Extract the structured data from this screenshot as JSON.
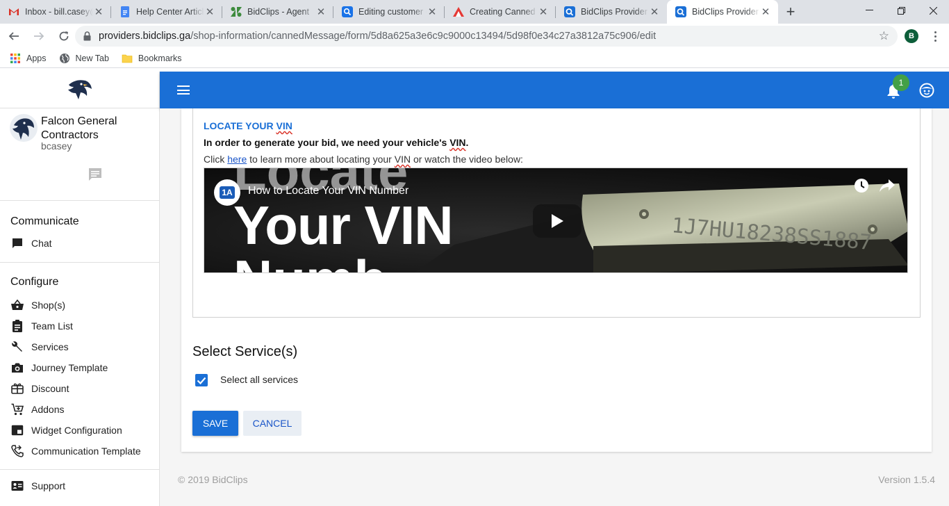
{
  "browser": {
    "tabs": [
      {
        "title": "Inbox - bill.casey@",
        "icon": "gmail-icon"
      },
      {
        "title": "Help Center Article",
        "icon": "docs-icon"
      },
      {
        "title": "BidClips - Agent",
        "icon": "zendesk-icon"
      },
      {
        "title": "Editing customer c",
        "icon": "search-icon"
      },
      {
        "title": "Creating Canned M",
        "icon": "triangle-icon"
      },
      {
        "title": "BidClips Provider P",
        "icon": "bidclips-icon"
      },
      {
        "title": "BidClips Provider P",
        "icon": "bidclips-icon",
        "active": true
      }
    ],
    "url_host": "providers.bidclips.ga",
    "url_path": "/shop-information/cannedMessage/form/5d8a625a3e6c9c9000c13494/5d98f0e34c27a3812a75c906/edit",
    "profile_initial": "B",
    "bookmarks": [
      {
        "label": "Apps",
        "icon": "apps-grid-icon"
      },
      {
        "label": "New Tab",
        "icon": "globe-icon"
      },
      {
        "label": "Bookmarks",
        "icon": "folder-icon"
      }
    ]
  },
  "sidebar": {
    "company": "Falcon General Contractors",
    "username": "bcasey",
    "sections": [
      {
        "title": "Communicate",
        "items": [
          {
            "label": "Chat",
            "icon": "chat-icon"
          }
        ]
      },
      {
        "title": "Configure",
        "items": [
          {
            "label": "Shop(s)",
            "icon": "basket-icon"
          },
          {
            "label": "Team List",
            "icon": "clipboard-icon"
          },
          {
            "label": "Services",
            "icon": "wrench-icon"
          },
          {
            "label": "Journey Template",
            "icon": "camera-icon"
          },
          {
            "label": "Discount",
            "icon": "gift-icon"
          },
          {
            "label": "Addons",
            "icon": "cart-plus-icon"
          },
          {
            "label": "Widget Configuration",
            "icon": "widget-icon"
          },
          {
            "label": "Communication Template",
            "icon": "phone-forward-icon"
          }
        ]
      }
    ],
    "support": {
      "label": "Support",
      "icon": "contact-card-icon"
    }
  },
  "topbar": {
    "notification_count": "1",
    "colors": {
      "primary": "#1a6fd6",
      "badge": "#43a047"
    }
  },
  "editor": {
    "heading_pre": "LOCATE YOUR ",
    "heading_vin": "VIN",
    "line1_pre": "In order to generate your bid, we need your vehicle's ",
    "line1_vin": "VIN",
    "line1_post": ".",
    "line2_pre": "Click ",
    "line2_link": "here",
    "line2_mid": " to learn more about locating your ",
    "line2_vin": "VIN",
    "line2_post": " or watch the video below:",
    "video": {
      "channel_badge": "1A",
      "title": "How to Locate Your VIN Number",
      "overlay_top": "Locate",
      "overlay_main": "Your VIN",
      "overlay_bottom": "Numb"
    }
  },
  "services": {
    "title": "Select Service(s)",
    "select_all_label": "Select all services",
    "select_all_checked": true
  },
  "actions": {
    "save": "SAVE",
    "cancel": "CANCEL"
  },
  "footer": {
    "copyright": "© 2019 BidClips",
    "version": "Version 1.5.4"
  }
}
